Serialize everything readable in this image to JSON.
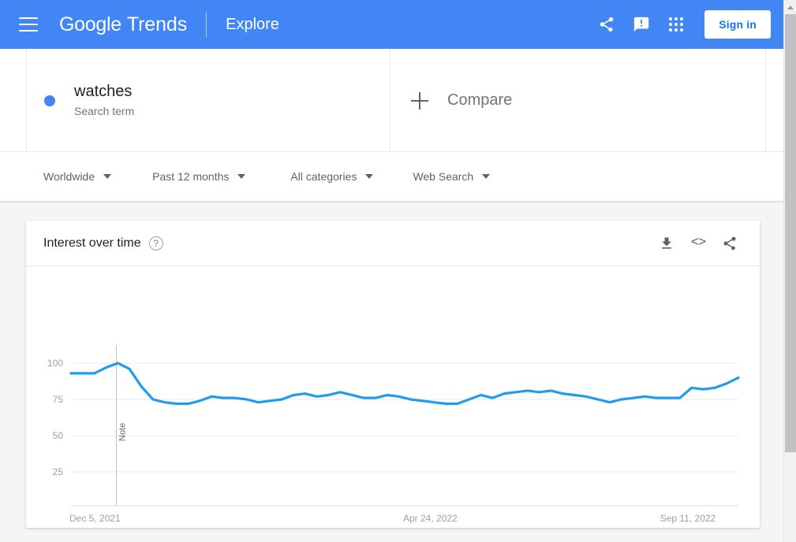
{
  "header": {
    "menu_icon": "hamburger-menu-icon",
    "brand_google": "Google",
    "brand_trends": "Trends",
    "explore": "Explore",
    "share_icon": "share-icon",
    "feedback_icon": "feedback-icon",
    "apps_icon": "apps-grid-icon",
    "sign_in": "Sign in",
    "bar_color": "#4285f4"
  },
  "search": {
    "term": "watches",
    "type_label": "Search term",
    "dot_color": "#4285f4",
    "compare_label": "Compare",
    "compare_icon": "plus-icon"
  },
  "filters": [
    {
      "label": "Worldwide",
      "name": "location-filter"
    },
    {
      "label": "Past 12 months",
      "name": "time-range-filter"
    },
    {
      "label": "All categories",
      "name": "category-filter"
    },
    {
      "label": "Web Search",
      "name": "search-type-filter"
    }
  ],
  "card": {
    "title": "Interest over time",
    "help_icon": "help-icon",
    "help_glyph": "?",
    "download_icon": "download-icon",
    "embed_icon": "embed-code-icon",
    "embed_glyph": "<>",
    "share_icon": "share-icon"
  },
  "chart_data": {
    "type": "line",
    "title": "Interest over time",
    "xlabel": "",
    "ylabel": "",
    "ylim": [
      0,
      100
    ],
    "yticks": [
      100,
      75,
      50,
      25
    ],
    "grid": true,
    "legend": "watches",
    "line_color": "#1f9bf0",
    "xtick_labels": [
      "Dec 5, 2021",
      "Apr 24, 2022",
      "Sep 11, 2022"
    ],
    "xtick_positions": [
      0,
      0.5,
      0.885
    ],
    "annotation": {
      "label": "Note",
      "x_fraction": 0.068
    },
    "x": [
      "2021-12-05",
      "2021-12-12",
      "2021-12-19",
      "2021-12-26",
      "2022-01-02",
      "2022-01-09",
      "2022-01-16",
      "2022-01-23",
      "2022-01-30",
      "2022-02-06",
      "2022-02-13",
      "2022-02-20",
      "2022-02-27",
      "2022-03-06",
      "2022-03-13",
      "2022-03-20",
      "2022-03-27",
      "2022-04-03",
      "2022-04-10",
      "2022-04-17",
      "2022-04-24",
      "2022-05-01",
      "2022-05-08",
      "2022-05-15",
      "2022-05-22",
      "2022-05-29",
      "2022-06-05",
      "2022-06-12",
      "2022-06-19",
      "2022-06-26",
      "2022-07-03",
      "2022-07-10",
      "2022-07-17",
      "2022-07-24",
      "2022-07-31",
      "2022-08-07",
      "2022-08-14",
      "2022-08-21",
      "2022-08-28",
      "2022-09-04",
      "2022-09-11",
      "2022-09-18",
      "2022-09-25",
      "2022-10-02",
      "2022-10-09",
      "2022-10-16",
      "2022-10-23",
      "2022-10-30",
      "2022-11-06",
      "2022-11-13",
      "2022-11-20",
      "2022-11-27"
    ],
    "values": [
      93,
      93,
      93,
      97,
      100,
      96,
      84,
      75,
      73,
      72,
      72,
      74,
      77,
      76,
      76,
      75,
      73,
      74,
      75,
      78,
      79,
      77,
      78,
      80,
      78,
      76,
      76,
      78,
      77,
      75,
      74,
      73,
      72,
      72,
      75,
      78,
      76,
      79,
      80,
      81,
      80,
      81,
      79,
      78,
      77,
      75,
      73,
      75,
      76,
      77,
      76,
      76
    ],
    "values_tail": [
      76,
      83,
      82,
      83,
      86,
      90
    ]
  }
}
